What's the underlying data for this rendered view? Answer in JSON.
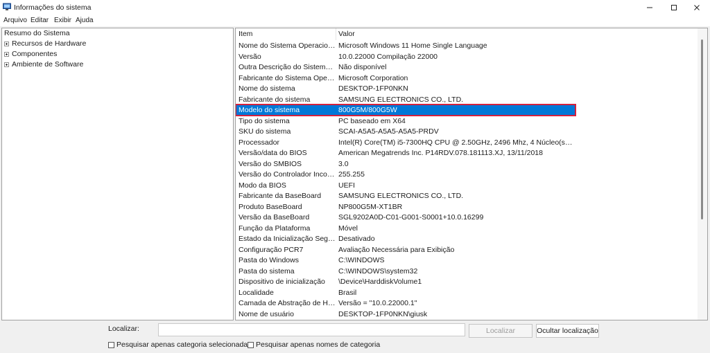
{
  "window": {
    "title": "Informações do sistema",
    "controls": [
      "minimize-icon",
      "maximize-icon",
      "close-icon"
    ]
  },
  "menu": [
    "Arquivo",
    "Editar",
    "Exibir",
    "Ajuda"
  ],
  "tree": {
    "root": "Resumo do Sistema",
    "nodes": [
      "Recursos de Hardware",
      "Componentes",
      "Ambiente de Software"
    ]
  },
  "list": {
    "headers": {
      "item": "Item",
      "value": "Valor"
    },
    "selected_index": 6,
    "rows": [
      {
        "item": "Nome do Sistema Operacional",
        "value": "Microsoft Windows 11 Home Single Language"
      },
      {
        "item": "Versão",
        "value": "10.0.22000 Compilação 22000"
      },
      {
        "item": "Outra Descrição do Sistema O...",
        "value": "Não disponível"
      },
      {
        "item": "Fabricante do Sistema Operac...",
        "value": "Microsoft Corporation"
      },
      {
        "item": "Nome do sistema",
        "value": "DESKTOP-1FP0NKN"
      },
      {
        "item": "Fabricante do sistema",
        "value": "SAMSUNG ELECTRONICS CO., LTD."
      },
      {
        "item": "Modelo do sistema",
        "value": "800G5M/800G5W"
      },
      {
        "item": "Tipo do sistema",
        "value": "PC baseado em X64"
      },
      {
        "item": "SKU do sistema",
        "value": "SCAI-A5A5-A5A5-A5A5-PRDV"
      },
      {
        "item": "Processador",
        "value": "Intel(R) Core(TM) i5-7300HQ CPU @ 2.50GHz, 2496 Mhz, 4 Núcleo(s), 4 Pro..."
      },
      {
        "item": "Versão/data do BIOS",
        "value": "American Megatrends Inc. P14RDV.078.181113.XJ, 13/11/2018"
      },
      {
        "item": "Versão do SMBIOS",
        "value": "3.0"
      },
      {
        "item": "Versão do Controlador Incorp...",
        "value": "255.255"
      },
      {
        "item": "Modo da BIOS",
        "value": "UEFI"
      },
      {
        "item": "Fabricante da BaseBoard",
        "value": "SAMSUNG ELECTRONICS CO., LTD."
      },
      {
        "item": "Produto BaseBoard",
        "value": "NP800G5M-XT1BR"
      },
      {
        "item": "Versão da BaseBoard",
        "value": "SGL9202A0D-C01-G001-S0001+10.0.16299"
      },
      {
        "item": "Função da Plataforma",
        "value": "Móvel"
      },
      {
        "item": "Estado da Inicialização Segura",
        "value": "Desativado"
      },
      {
        "item": "Configuração PCR7",
        "value": "Avaliação Necessária para Exibição"
      },
      {
        "item": "Pasta do Windows",
        "value": "C:\\WINDOWS"
      },
      {
        "item": "Pasta do sistema",
        "value": "C:\\WINDOWS\\system32"
      },
      {
        "item": "Dispositivo de inicialização",
        "value": "\\Device\\HarddiskVolume1"
      },
      {
        "item": "Localidade",
        "value": "Brasil"
      },
      {
        "item": "Camada de Abstração de Har...",
        "value": "Versão = \"10.0.22000.1\""
      },
      {
        "item": "Nome de usuário",
        "value": "DESKTOP-1FP0NKN\\giusk"
      }
    ]
  },
  "search": {
    "label": "Localizar:",
    "value": "",
    "find_button": "Localizar",
    "hide_button": "Ocultar localização",
    "checkbox_category": "Pesquisar apenas categoria selecionada",
    "checkbox_names": "Pesquisar apenas nomes de categoria"
  },
  "colors": {
    "selection": "#0078d7",
    "highlight_border": "#d4213d"
  }
}
